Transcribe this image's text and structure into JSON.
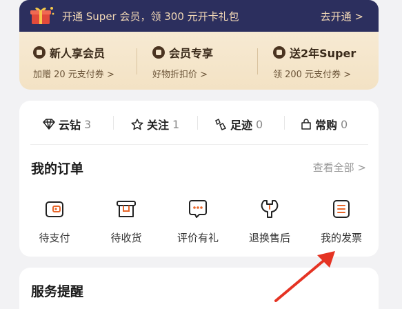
{
  "banner": {
    "text": "开通 Super 会员，领 300 元开卡礼包",
    "cta": "去开通 >"
  },
  "perks": [
    {
      "title": "新人享会员",
      "subtitle": "加赠 20 元支付券 >",
      "icon": "badge-icon"
    },
    {
      "title": "会员专享",
      "subtitle": "好物折扣价 >",
      "icon": "bag-icon"
    },
    {
      "title": "送2年Super",
      "subtitle": "领 200 元支付券 >",
      "icon": "gift-icon"
    }
  ],
  "stats": [
    {
      "label": "云钻",
      "count": "3",
      "icon": "diamond-icon"
    },
    {
      "label": "关注",
      "count": "1",
      "icon": "star-icon"
    },
    {
      "label": "足迹",
      "count": "0",
      "icon": "footprint-icon"
    },
    {
      "label": "常购",
      "count": "0",
      "icon": "shopping-bag-icon"
    }
  ],
  "orders": {
    "title": "我的订单",
    "view_all": "查看全部 >",
    "items": [
      {
        "label": "待支付",
        "icon": "wallet-icon"
      },
      {
        "label": "待收货",
        "icon": "package-icon"
      },
      {
        "label": "评价有礼",
        "icon": "comment-icon"
      },
      {
        "label": "退换售后",
        "icon": "wrench-icon"
      },
      {
        "label": "我的发票",
        "icon": "invoice-icon"
      }
    ]
  },
  "service": {
    "title": "服务提醒"
  },
  "colors": {
    "accent_orange": "#e8662a",
    "banner_bg": "#2c2f5e",
    "annotation_red": "#e53323"
  }
}
